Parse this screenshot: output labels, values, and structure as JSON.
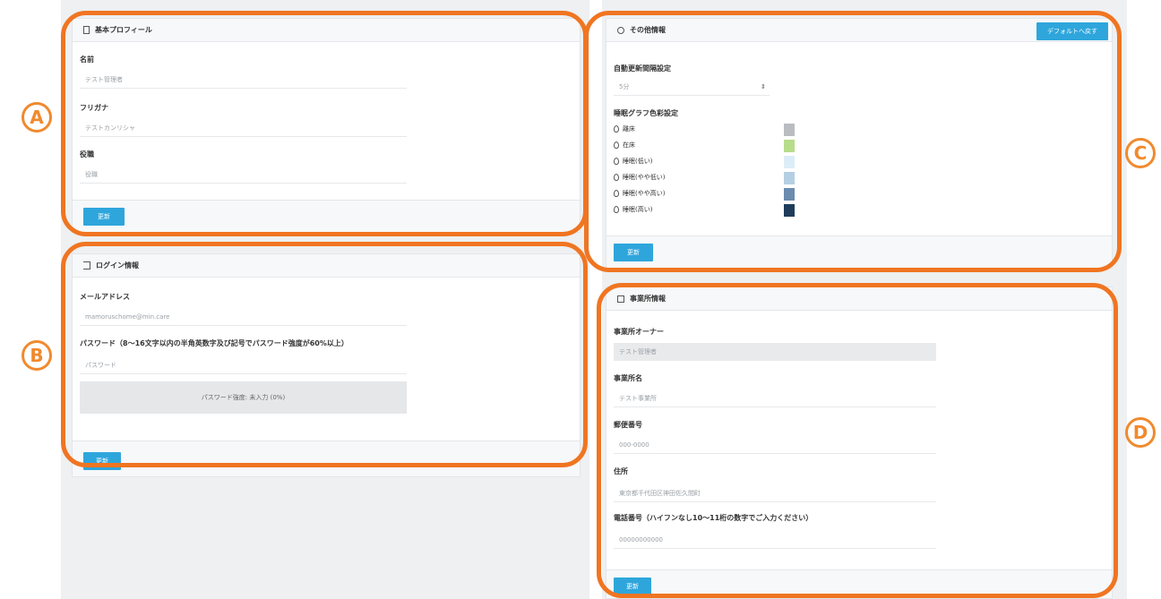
{
  "badges": {
    "a": "A",
    "b": "B",
    "c": "C",
    "d": "D"
  },
  "profile": {
    "title": "基本プロフィール",
    "name_label": "名前",
    "name_value": "テスト管理者",
    "kana_label": "フリガナ",
    "kana_value": "テストカンリシャ",
    "role_label": "役職",
    "role_placeholder": "役職",
    "update_label": "更新"
  },
  "login": {
    "title": "ログイン情報",
    "email_label": "メールアドレス",
    "email_value": "mamoruschome@min.care",
    "password_label": "パスワード（8〜16文字以内の半角英数字及び記号でパスワード強度が60%以上）",
    "password_placeholder": "パスワード",
    "strength_text": "パスワード強度: 未入力 (0%)",
    "update_label": "更新"
  },
  "other": {
    "title": "その他情報",
    "reset_label": "デフォルトへ戻す",
    "interval_label": "自動更新間隔設定",
    "interval_value": "5分",
    "graph_label": "睡眠グラフ色彩設定",
    "legend": [
      {
        "label": "離床",
        "color": "#b9bdc1"
      },
      {
        "label": "在床",
        "color": "#b7dc8b"
      },
      {
        "label": "睡眠(低い)",
        "color": "#dcedf8"
      },
      {
        "label": "睡眠(やや低い)",
        "color": "#b5cfe2"
      },
      {
        "label": "睡眠(やや高い)",
        "color": "#6b8cae"
      },
      {
        "label": "睡眠(高い)",
        "color": "#1f3c5a"
      }
    ],
    "update_label": "更新"
  },
  "office": {
    "title": "事業所情報",
    "owner_label": "事業所オーナー",
    "owner_value": "テスト管理者",
    "office_name_label": "事業所名",
    "office_name_value": "テスト事業所",
    "zip_label": "郵便番号",
    "zip_value": "000-0000",
    "address_label": "住所",
    "address_value": "東京都千代田区神田佐久間町",
    "phone_label": "電話番号（ハイフンなし10〜11桁の数字でご入力ください）",
    "phone_value": "00000000000",
    "update_label": "更新"
  },
  "colors": {
    "accent": "#2ea6dc",
    "annotation": "#f07521"
  }
}
